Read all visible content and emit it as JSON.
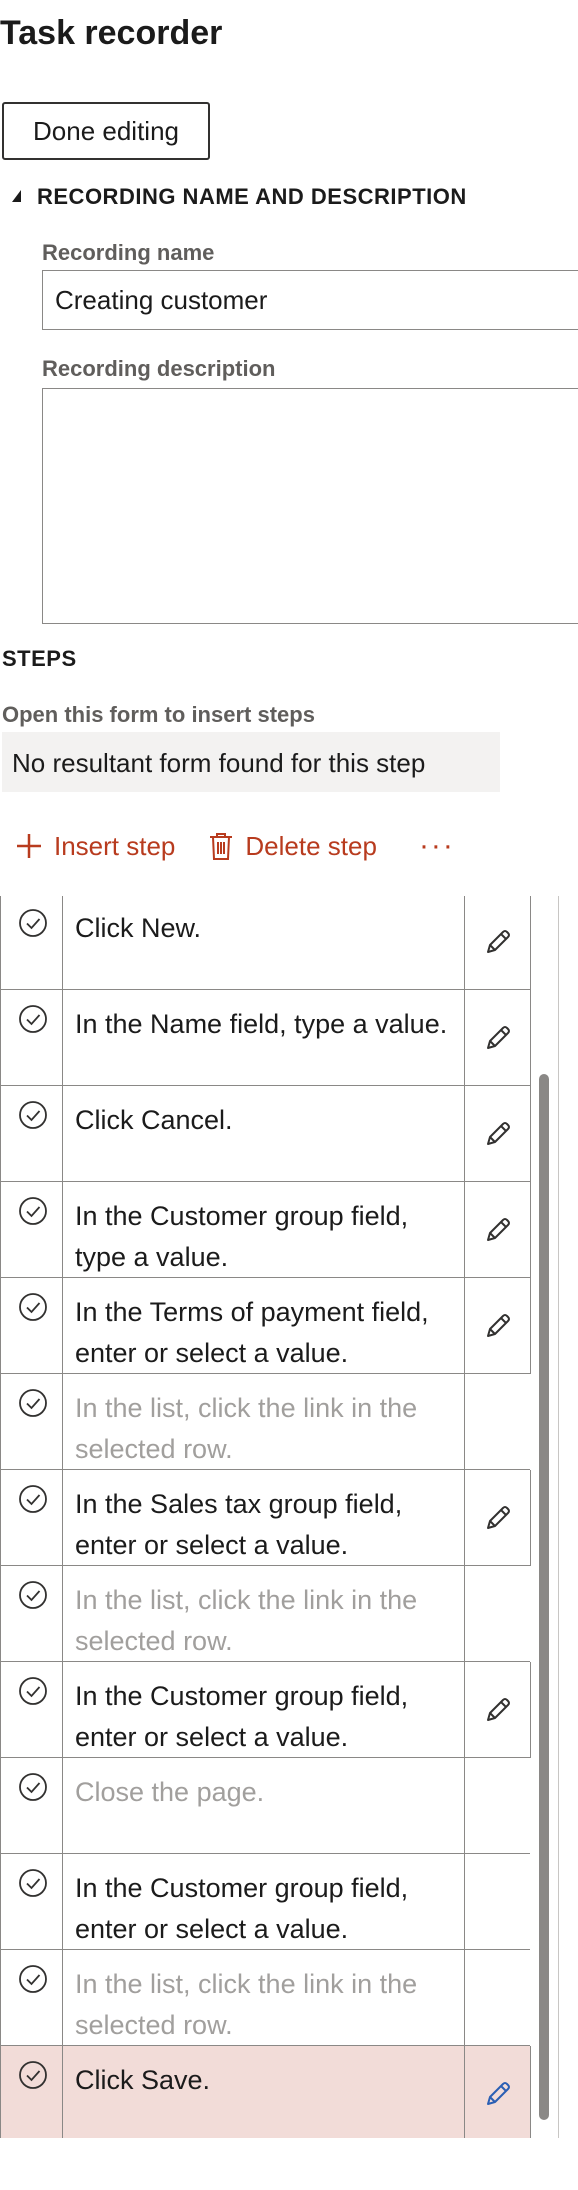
{
  "app": {
    "title": "Task recorder"
  },
  "toolbar_top": {
    "done_label": "Done editing"
  },
  "recording": {
    "section_label": "RECORDING NAME AND DESCRIPTION",
    "name_label": "Recording name",
    "name_value": "Creating customer",
    "description_label": "Recording description",
    "description_value": ""
  },
  "steps": {
    "section_label": "STEPS",
    "open_form_label": "Open this form to insert steps",
    "open_form_value": "No resultant form found for this step",
    "insert_label": "Insert step",
    "delete_label": "Delete step",
    "more_label": "···",
    "items": [
      {
        "text": "Click New.",
        "dimmed": false,
        "editable": true,
        "selected": false
      },
      {
        "text": "In the Name field, type a value.",
        "dimmed": false,
        "editable": true,
        "selected": false
      },
      {
        "text": "Click Cancel.",
        "dimmed": false,
        "editable": true,
        "selected": false
      },
      {
        "text": "In the Customer group field, type a value.",
        "dimmed": false,
        "editable": true,
        "selected": false
      },
      {
        "text": "In the Terms of payment field, enter or select a value.",
        "dimmed": false,
        "editable": true,
        "selected": false
      },
      {
        "text": "In the list, click the link in the selected row.",
        "dimmed": true,
        "editable": false,
        "selected": false
      },
      {
        "text": "In the Sales tax group field, enter or select a value.",
        "dimmed": false,
        "editable": true,
        "selected": false
      },
      {
        "text": "In the list, click the link in the selected row.",
        "dimmed": true,
        "editable": false,
        "selected": false
      },
      {
        "text": "In the Customer group field, enter or select a value.",
        "dimmed": false,
        "editable": true,
        "selected": false
      },
      {
        "text": "Close the page.",
        "dimmed": true,
        "editable": false,
        "selected": false
      },
      {
        "text": "In the Customer group field, enter or select a value.",
        "dimmed": false,
        "editable": false,
        "selected": false
      },
      {
        "text": "In the list, click the link in the selected row.",
        "dimmed": true,
        "editable": false,
        "selected": false
      },
      {
        "text": "Click Save.",
        "dimmed": false,
        "editable": true,
        "selected": true
      }
    ]
  },
  "colors": {
    "accent": "#b83b1e",
    "selected_row": "#f2dcd8",
    "edit_icon_selected": "#2b5fb4"
  }
}
